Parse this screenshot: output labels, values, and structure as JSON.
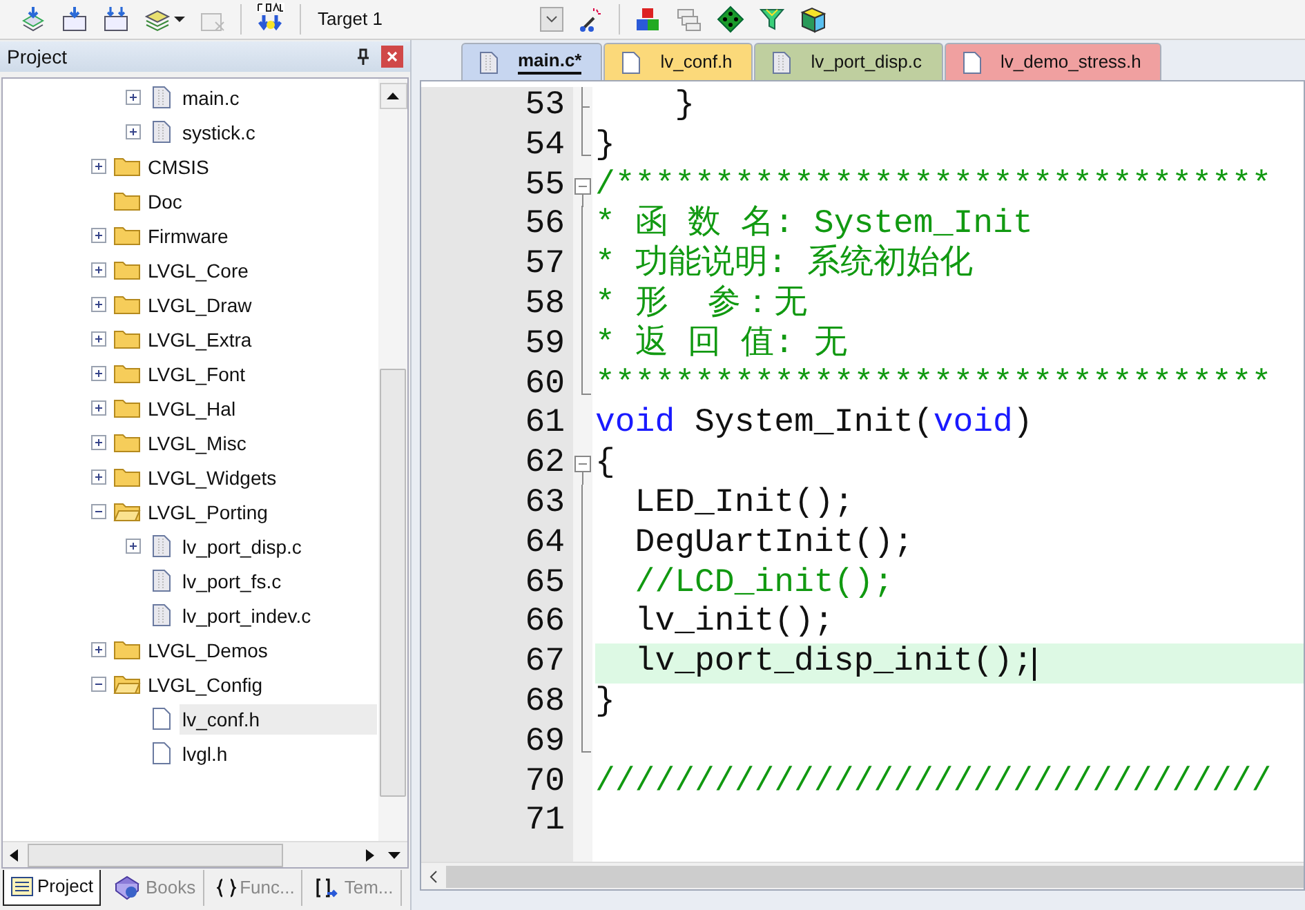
{
  "toolbar": {
    "target": "Target 1"
  },
  "project_panel": {
    "title": "Project",
    "tree": [
      {
        "children": [
          {
            "label": "main.c",
            "kind": "file",
            "expanded": false,
            "selected": false
          },
          {
            "label": "systick.c",
            "kind": "file",
            "expanded": false,
            "selected": false
          }
        ]
      },
      {
        "label": "CMSIS",
        "kind": "folder",
        "expanded": false,
        "selected": false
      },
      {
        "label": "Doc",
        "kind": "folder",
        "selected": false
      },
      {
        "label": "Firmware",
        "kind": "folder",
        "expanded": false,
        "selected": false
      },
      {
        "label": "LVGL_Core",
        "kind": "folder",
        "expanded": false,
        "selected": false
      },
      {
        "label": "LVGL_Draw",
        "kind": "folder",
        "expanded": false,
        "selected": false
      },
      {
        "label": "LVGL_Extra",
        "kind": "folder",
        "expanded": false,
        "selected": false
      },
      {
        "label": "LVGL_Font",
        "kind": "folder",
        "expanded": false,
        "selected": false
      },
      {
        "label": "LVGL_Hal",
        "kind": "folder",
        "expanded": false,
        "selected": false
      },
      {
        "label": "LVGL_Misc",
        "kind": "folder",
        "expanded": false,
        "selected": false
      },
      {
        "label": "LVGL_Widgets",
        "kind": "folder",
        "expanded": false,
        "selected": false
      },
      {
        "label": "LVGL_Porting",
        "kind": "folder",
        "expanded": true,
        "selected": false,
        "children": [
          {
            "label": "lv_port_disp.c",
            "kind": "file",
            "expanded": false,
            "selected": false
          },
          {
            "label": "lv_port_fs.c",
            "kind": "file",
            "selected": false
          },
          {
            "label": "lv_port_indev.c",
            "kind": "file",
            "selected": false
          }
        ]
      },
      {
        "label": "LVGL_Demos",
        "kind": "folder",
        "expanded": false,
        "selected": false
      },
      {
        "label": "LVGL_Config",
        "kind": "folder",
        "expanded": true,
        "selected": false,
        "children": [
          {
            "label": "lv_conf.h",
            "kind": "header",
            "selected": true
          },
          {
            "label": "lvgl.h",
            "kind": "header",
            "selected": false
          }
        ]
      }
    ],
    "bottom_tabs": [
      {
        "label": "Project",
        "kind": "project",
        "selected": true
      },
      {
        "label": "Books",
        "kind": "books",
        "selected": false
      },
      {
        "label": "Func...",
        "kind": "functions",
        "selected": false
      },
      {
        "label": "Tem...",
        "kind": "templates",
        "selected": false
      }
    ]
  },
  "editor": {
    "tabs": [
      {
        "label": "main.c*",
        "color": "#c7d6f0",
        "selected": true
      },
      {
        "label": "lv_conf.h",
        "color": "#fbd97a",
        "selected": false
      },
      {
        "label": "lv_port_disp.c",
        "color": "#bfcf9f",
        "selected": false
      },
      {
        "label": "lv_demo_stress.h",
        "color": "#f0a0a0",
        "selected": false
      }
    ],
    "lines": [
      {
        "number": "53",
        "kind": "branch",
        "current": false,
        "tokens": [
          {
            "kind": "plain",
            "text": "    }"
          }
        ]
      },
      {
        "number": "54",
        "kind": "end",
        "current": false,
        "tokens": [
          {
            "kind": "plain",
            "text": "}"
          }
        ]
      },
      {
        "number": "55",
        "kind": "start",
        "current": false,
        "tokens": [
          {
            "kind": "comment",
            "text": "/*********************************"
          }
        ]
      },
      {
        "number": "56",
        "kind": "inside",
        "current": false,
        "tokens": [
          {
            "kind": "comment",
            "text": "* 函 数 名: System_Init"
          }
        ]
      },
      {
        "number": "57",
        "kind": "inside",
        "current": false,
        "tokens": [
          {
            "kind": "comment",
            "text": "* 功能说明: 系统初始化"
          }
        ]
      },
      {
        "number": "58",
        "kind": "inside",
        "current": false,
        "tokens": [
          {
            "kind": "comment",
            "text": "* 形  参：无"
          }
        ]
      },
      {
        "number": "59",
        "kind": "inside",
        "current": false,
        "tokens": [
          {
            "kind": "comment",
            "text": "* 返 回 值: 无"
          }
        ]
      },
      {
        "number": "60",
        "kind": "end",
        "current": false,
        "tokens": [
          {
            "kind": "comment",
            "text": "**********************************"
          }
        ]
      },
      {
        "number": "61",
        "kind": "plain",
        "current": false,
        "tokens": [
          {
            "kind": "keyword",
            "text": "void"
          },
          {
            "kind": "plain",
            "text": " System_Init("
          },
          {
            "kind": "keyword",
            "text": "void"
          },
          {
            "kind": "plain",
            "text": ")"
          }
        ]
      },
      {
        "number": "62",
        "kind": "start",
        "current": false,
        "tokens": [
          {
            "kind": "plain",
            "text": "{"
          }
        ]
      },
      {
        "number": "63",
        "kind": "inside",
        "current": false,
        "tokens": [
          {
            "kind": "plain",
            "text": "  LED_Init();"
          }
        ]
      },
      {
        "number": "64",
        "kind": "inside",
        "current": false,
        "tokens": [
          {
            "kind": "plain",
            "text": "  DegUartInit();"
          }
        ]
      },
      {
        "number": "65",
        "kind": "inside",
        "current": false,
        "tokens": [
          {
            "kind": "comment",
            "text": "  //LCD_init();"
          }
        ]
      },
      {
        "number": "66",
        "kind": "inside",
        "current": false,
        "tokens": [
          {
            "kind": "plain",
            "text": "  lv_init();"
          }
        ]
      },
      {
        "number": "67",
        "kind": "inside",
        "current": true,
        "tokens": [
          {
            "kind": "plain",
            "text": "  lv_port_disp_init();"
          }
        ]
      },
      {
        "number": "68",
        "kind": "inside",
        "current": false,
        "tokens": [
          {
            "kind": "plain",
            "text": "}"
          }
        ]
      },
      {
        "number": "69",
        "kind": "end",
        "current": false
      },
      {
        "number": "70",
        "kind": "plain",
        "current": false,
        "tokens": [
          {
            "kind": "comment",
            "text": "//////////////////////////////////"
          }
        ]
      },
      {
        "number": "71",
        "kind": "plain",
        "current": false
      }
    ]
  }
}
